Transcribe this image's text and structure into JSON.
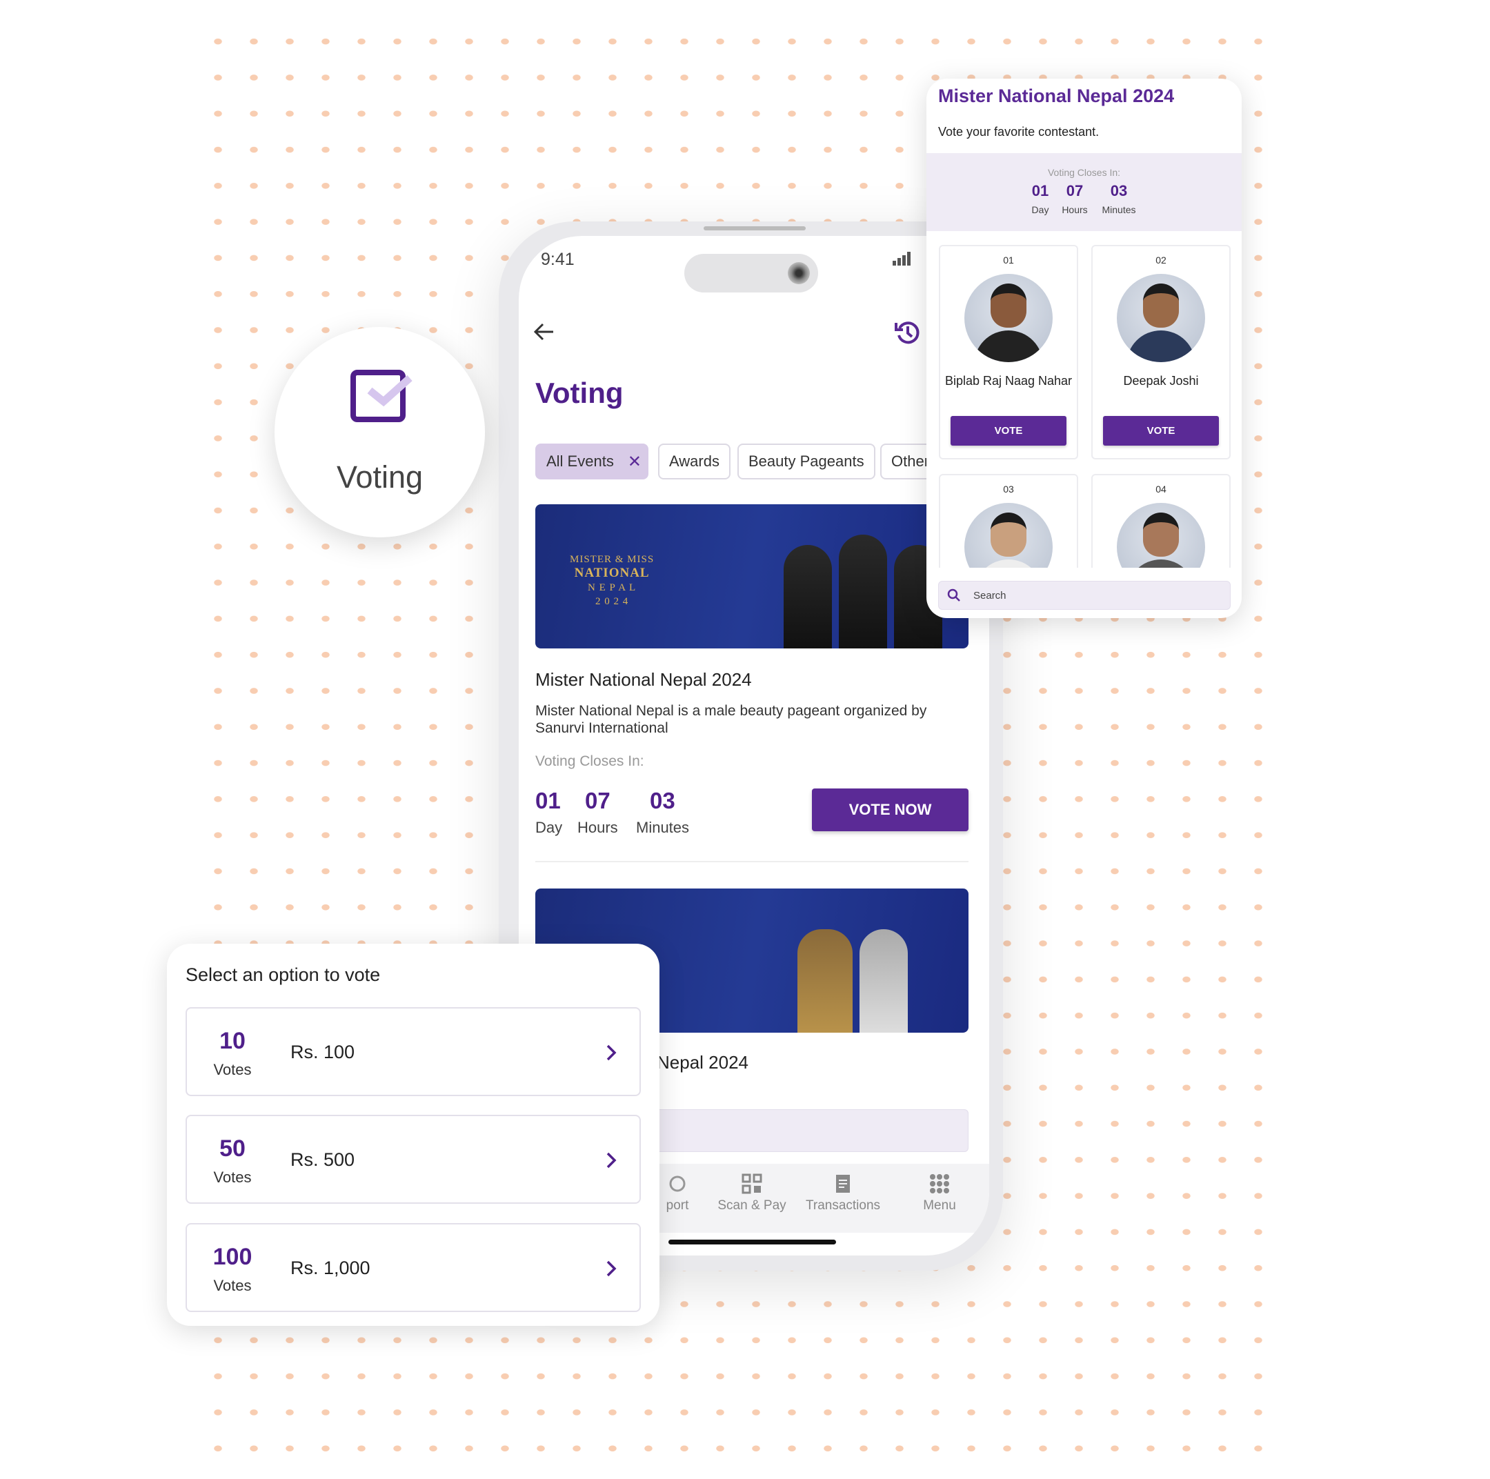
{
  "feature_badge": {
    "label": "Voting",
    "icon": "checkbox-icon"
  },
  "phone": {
    "status_time": "9:41",
    "page_title": "Voting",
    "filters": [
      {
        "label": "All Events",
        "active": true
      },
      {
        "label": "Awards"
      },
      {
        "label": "Beauty Pageants"
      },
      {
        "label": "Other"
      }
    ],
    "events": [
      {
        "banner_logo": "MISTER & MISS NATIONAL NEPAL 2024",
        "title": "Mister National Nepal 2024",
        "description": "Mister National Nepal is a male beauty pageant organized by Sanurvi International",
        "closes_label": "Voting Closes In:",
        "countdown": [
          {
            "value": "01",
            "unit": "Day"
          },
          {
            "value": "07",
            "unit": "Hours"
          },
          {
            "value": "03",
            "unit": "Minutes"
          }
        ],
        "cta": "VOTE NOW"
      },
      {
        "title_partial": "Nepal 2024"
      }
    ],
    "bottom_nav": [
      {
        "label": "port",
        "icon": "support-icon"
      },
      {
        "label": "Scan & Pay",
        "icon": "qr-icon"
      },
      {
        "label": "Transactions",
        "icon": "receipt-icon"
      },
      {
        "label": "Menu",
        "icon": "grid-icon"
      }
    ]
  },
  "contest_panel": {
    "title": "Mister National Nepal 2024",
    "subtitle": "Vote your favorite contestant.",
    "closes_label": "Voting Closes In:",
    "countdown": [
      {
        "value": "01",
        "unit": "Day"
      },
      {
        "value": "07",
        "unit": "Hours"
      },
      {
        "value": "03",
        "unit": "Minutes"
      }
    ],
    "contestants": [
      {
        "number": "01",
        "name": "Biplab Raj Naag Nahar",
        "vote": "VOTE"
      },
      {
        "number": "02",
        "name": "Deepak Joshi",
        "vote": "VOTE"
      },
      {
        "number": "03"
      },
      {
        "number": "04"
      }
    ],
    "search_placeholder": "Search"
  },
  "vote_options": {
    "title": "Select an option to vote",
    "options": [
      {
        "votes": "10",
        "unit": "Votes",
        "price": "Rs. 100"
      },
      {
        "votes": "50",
        "unit": "Votes",
        "price": "Rs. 500"
      },
      {
        "votes": "100",
        "unit": "Votes",
        "price": "Rs. 1,000"
      }
    ]
  },
  "colors": {
    "accent": "#5b2a96",
    "chip_active": "#d8cbe7",
    "dots": "#f8cdb1",
    "band": "#efebf5"
  }
}
